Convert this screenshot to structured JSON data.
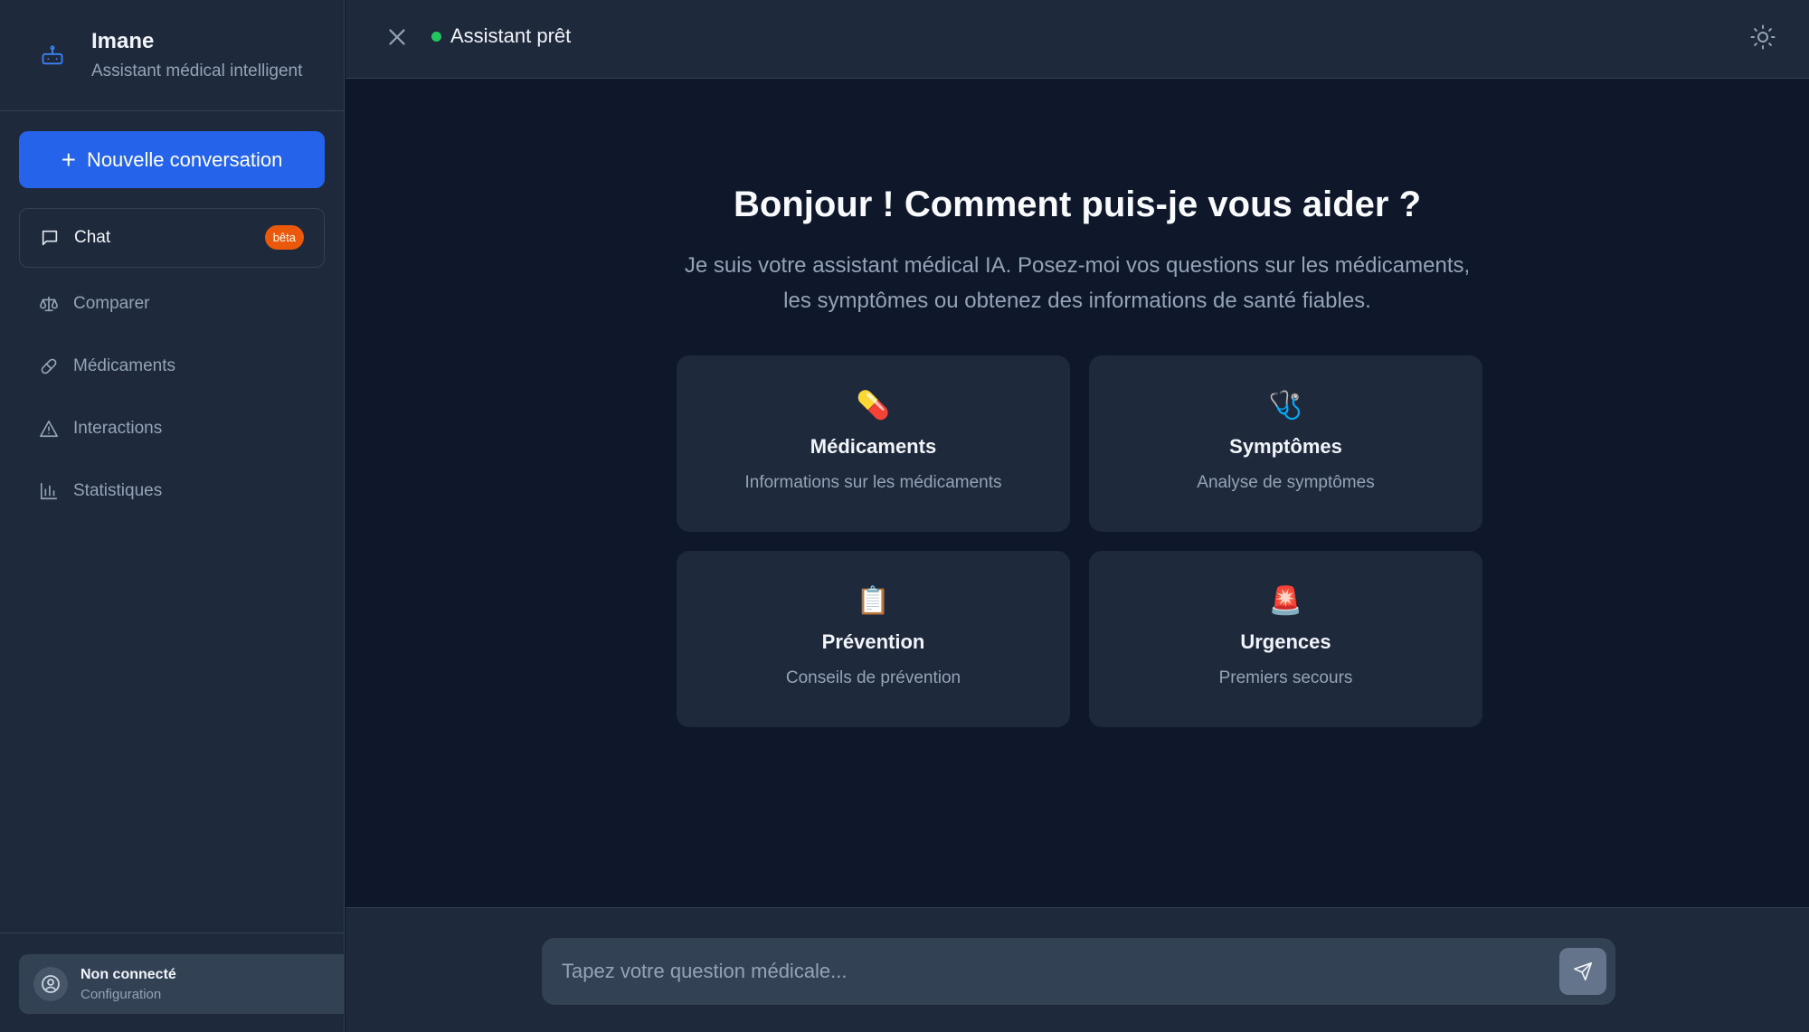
{
  "brand": {
    "name": "Imane",
    "subtitle": "Assistant médical intelligent",
    "icon": "robot-icon"
  },
  "sidebar": {
    "new_conversation": "Nouvelle conversation",
    "items": [
      {
        "label": "Chat",
        "icon": "message-icon",
        "badge": "bêta",
        "active": true
      },
      {
        "label": "Comparer",
        "icon": "scale-icon"
      },
      {
        "label": "Médicaments",
        "icon": "pill-icon"
      },
      {
        "label": "Interactions",
        "icon": "warning-icon"
      },
      {
        "label": "Statistiques",
        "icon": "bar-chart-icon"
      }
    ],
    "user": {
      "status": "Non connecté",
      "action": "Configuration"
    }
  },
  "header": {
    "status": "Assistant prêt",
    "status_color": "#22c55e"
  },
  "hero": {
    "title": "Bonjour ! Comment puis-je vous aider ?",
    "subtitle": "Je suis votre assistant médical IA. Posez-moi vos questions sur les médicaments, les symptômes ou obtenez des informations de santé fiables."
  },
  "cards": [
    {
      "emoji": "💊",
      "title": "Médicaments",
      "desc": "Informations sur les médicaments"
    },
    {
      "emoji": "🩺",
      "title": "Symptômes",
      "desc": "Analyse de symptômes"
    },
    {
      "emoji": "📋",
      "title": "Prévention",
      "desc": "Conseils de prévention"
    },
    {
      "emoji": "🚨",
      "title": "Urgences",
      "desc": "Premiers secours"
    }
  ],
  "composer": {
    "placeholder": "Tapez votre question médicale..."
  },
  "colors": {
    "accent": "#2563eb",
    "badge": "#ea580c",
    "background": "#0f172a",
    "panel": "#1e293b"
  }
}
